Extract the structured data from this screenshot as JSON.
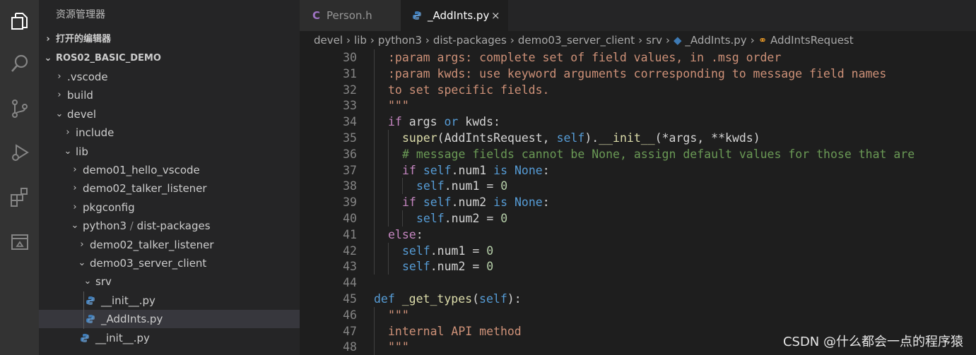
{
  "sidebar": {
    "title": "资源管理器",
    "sections": [
      {
        "label": "打开的编辑器",
        "expanded": false
      },
      {
        "label": "ROS02_BASIC_DEMO",
        "expanded": true
      }
    ],
    "tree": [
      {
        "label": ".vscode",
        "level": 0,
        "type": "folder",
        "expanded": false
      },
      {
        "label": "build",
        "level": 0,
        "type": "folder",
        "expanded": false
      },
      {
        "label": "devel",
        "level": 0,
        "type": "folder",
        "expanded": true
      },
      {
        "label": "include",
        "level": 1,
        "type": "folder",
        "expanded": false
      },
      {
        "label": "lib",
        "level": 1,
        "type": "folder",
        "expanded": true
      },
      {
        "label": "demo01_hello_vscode",
        "level": 2,
        "type": "folder",
        "expanded": false
      },
      {
        "label": "demo02_talker_listener",
        "level": 2,
        "type": "folder",
        "expanded": false
      },
      {
        "label": "pkgconfig",
        "level": 2,
        "type": "folder",
        "expanded": false
      },
      {
        "label": "python3",
        "label2": "dist-packages",
        "level": 2,
        "type": "folder",
        "expanded": true
      },
      {
        "label": "demo02_talker_listener",
        "level": 3,
        "type": "folder",
        "expanded": false
      },
      {
        "label": "demo03_server_client",
        "level": 3,
        "type": "folder",
        "expanded": true
      },
      {
        "label": "srv",
        "level": 4,
        "type": "folder",
        "expanded": true
      },
      {
        "label": "__init__.py",
        "level": 5,
        "type": "file"
      },
      {
        "label": "_AddInts.py",
        "level": 5,
        "type": "file",
        "selected": true
      },
      {
        "label": "__init__.py",
        "level": 4,
        "type": "file"
      }
    ]
  },
  "tabs": [
    {
      "label": "Person.h",
      "icon": "c-lang-icon",
      "active": false
    },
    {
      "label": "_AddInts.py",
      "icon": "python-icon",
      "active": true,
      "close": "×"
    }
  ],
  "breadcrumb": [
    "devel",
    "lib",
    "python3",
    "dist-packages",
    "demo03_server_client",
    "srv",
    "_AddInts.py",
    "AddIntsRequest"
  ],
  "editor": {
    "lines": [
      {
        "n": "30",
        "indent": 1,
        "tokens": [
          [
            "str",
            ":param args: complete set of field values, in .msg order"
          ]
        ]
      },
      {
        "n": "31",
        "indent": 1,
        "tokens": [
          [
            "str",
            ":param kwds: use keyword arguments corresponding to message field names"
          ]
        ]
      },
      {
        "n": "32",
        "indent": 1,
        "tokens": [
          [
            "str",
            "to set specific fields."
          ]
        ]
      },
      {
        "n": "33",
        "indent": 1,
        "tokens": [
          [
            "str",
            "\"\"\""
          ]
        ]
      },
      {
        "n": "34",
        "indent": 1,
        "tokens": [
          [
            "ctl",
            "if"
          ],
          [
            "plain",
            " args "
          ],
          [
            "kw",
            "or"
          ],
          [
            "plain",
            " kwds:"
          ]
        ]
      },
      {
        "n": "35",
        "indent": 2,
        "tokens": [
          [
            "fn",
            "super"
          ],
          [
            "plain",
            "(AddIntsRequest, "
          ],
          [
            "slf",
            "self"
          ],
          [
            "plain",
            ")."
          ],
          [
            "fn",
            "__init__"
          ],
          [
            "plain",
            "(*args, **kwds)"
          ]
        ]
      },
      {
        "n": "36",
        "indent": 2,
        "tokens": [
          [
            "cm",
            "# message fields cannot be None, assign default values for those that are"
          ]
        ]
      },
      {
        "n": "37",
        "indent": 2,
        "tokens": [
          [
            "ctl",
            "if"
          ],
          [
            "plain",
            " "
          ],
          [
            "slf",
            "self"
          ],
          [
            "plain",
            ".num1 "
          ],
          [
            "kw",
            "is"
          ],
          [
            "plain",
            " "
          ],
          [
            "kw",
            "None"
          ],
          [
            "plain",
            ":"
          ]
        ]
      },
      {
        "n": "38",
        "indent": 3,
        "tokens": [
          [
            "slf",
            "self"
          ],
          [
            "plain",
            ".num1 = "
          ],
          [
            "num",
            "0"
          ]
        ]
      },
      {
        "n": "39",
        "indent": 2,
        "tokens": [
          [
            "ctl",
            "if"
          ],
          [
            "plain",
            " "
          ],
          [
            "slf",
            "self"
          ],
          [
            "plain",
            ".num2 "
          ],
          [
            "kw",
            "is"
          ],
          [
            "plain",
            " "
          ],
          [
            "kw",
            "None"
          ],
          [
            "plain",
            ":"
          ]
        ]
      },
      {
        "n": "40",
        "indent": 3,
        "tokens": [
          [
            "slf",
            "self"
          ],
          [
            "plain",
            ".num2 = "
          ],
          [
            "num",
            "0"
          ]
        ]
      },
      {
        "n": "41",
        "indent": 1,
        "tokens": [
          [
            "ctl",
            "else"
          ],
          [
            "plain",
            ":"
          ]
        ]
      },
      {
        "n": "42",
        "indent": 2,
        "tokens": [
          [
            "slf",
            "self"
          ],
          [
            "plain",
            ".num1 = "
          ],
          [
            "num",
            "0"
          ]
        ]
      },
      {
        "n": "43",
        "indent": 2,
        "tokens": [
          [
            "slf",
            "self"
          ],
          [
            "plain",
            ".num2 = "
          ],
          [
            "num",
            "0"
          ]
        ]
      },
      {
        "n": "44",
        "indent": 0,
        "tokens": []
      },
      {
        "n": "45",
        "indent": 0,
        "tokens": [
          [
            "kw",
            "def"
          ],
          [
            "plain",
            " "
          ],
          [
            "fn",
            "_get_types"
          ],
          [
            "plain",
            "("
          ],
          [
            "slf",
            "self"
          ],
          [
            "plain",
            "):"
          ]
        ]
      },
      {
        "n": "46",
        "indent": 1,
        "tokens": [
          [
            "str",
            "\"\"\""
          ]
        ]
      },
      {
        "n": "47",
        "indent": 1,
        "tokens": [
          [
            "str",
            "internal API method"
          ]
        ]
      },
      {
        "n": "48",
        "indent": 1,
        "tokens": [
          [
            "str",
            "\"\"\""
          ]
        ]
      }
    ]
  },
  "watermark": "CSDN @什么都会一点的程序猿",
  "colors": {
    "accent": "#007acc",
    "python": "#3e7ab4",
    "c_icon": "#a074c4"
  }
}
